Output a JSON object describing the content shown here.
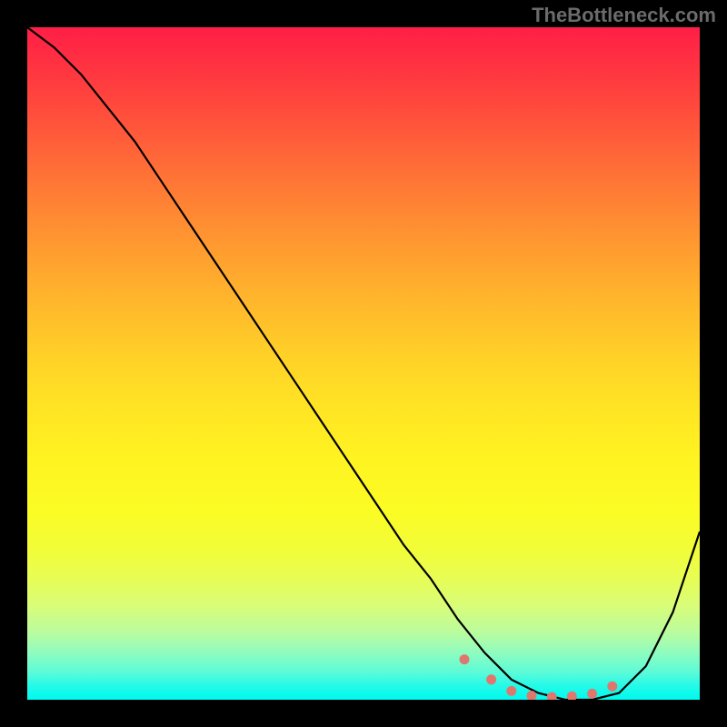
{
  "watermark": "TheBottleneck.com",
  "chart_data": {
    "type": "line",
    "title": "",
    "xlabel": "",
    "ylabel": "",
    "xlim": [
      0,
      100
    ],
    "ylim": [
      0,
      100
    ],
    "series": [
      {
        "name": "bottleneck-curve",
        "x": [
          0,
          4,
          8,
          12,
          16,
          20,
          24,
          28,
          32,
          36,
          40,
          44,
          48,
          52,
          56,
          60,
          64,
          68,
          72,
          76,
          80,
          84,
          88,
          92,
          96,
          100
        ],
        "y": [
          100,
          97,
          93,
          88,
          83,
          77,
          71,
          65,
          59,
          53,
          47,
          41,
          35,
          29,
          23,
          18,
          12,
          7,
          3,
          1,
          0,
          0,
          1,
          5,
          13,
          25
        ]
      }
    ],
    "markers": {
      "name": "highlight-dots",
      "x": [
        65,
        69,
        72,
        75,
        78,
        81,
        84,
        87
      ],
      "y": [
        6,
        3,
        1.3,
        0.6,
        0.4,
        0.5,
        0.9,
        2
      ]
    },
    "gradient_meaning": "top_red_high_bottleneck_to_bottom_green_low_bottleneck"
  }
}
